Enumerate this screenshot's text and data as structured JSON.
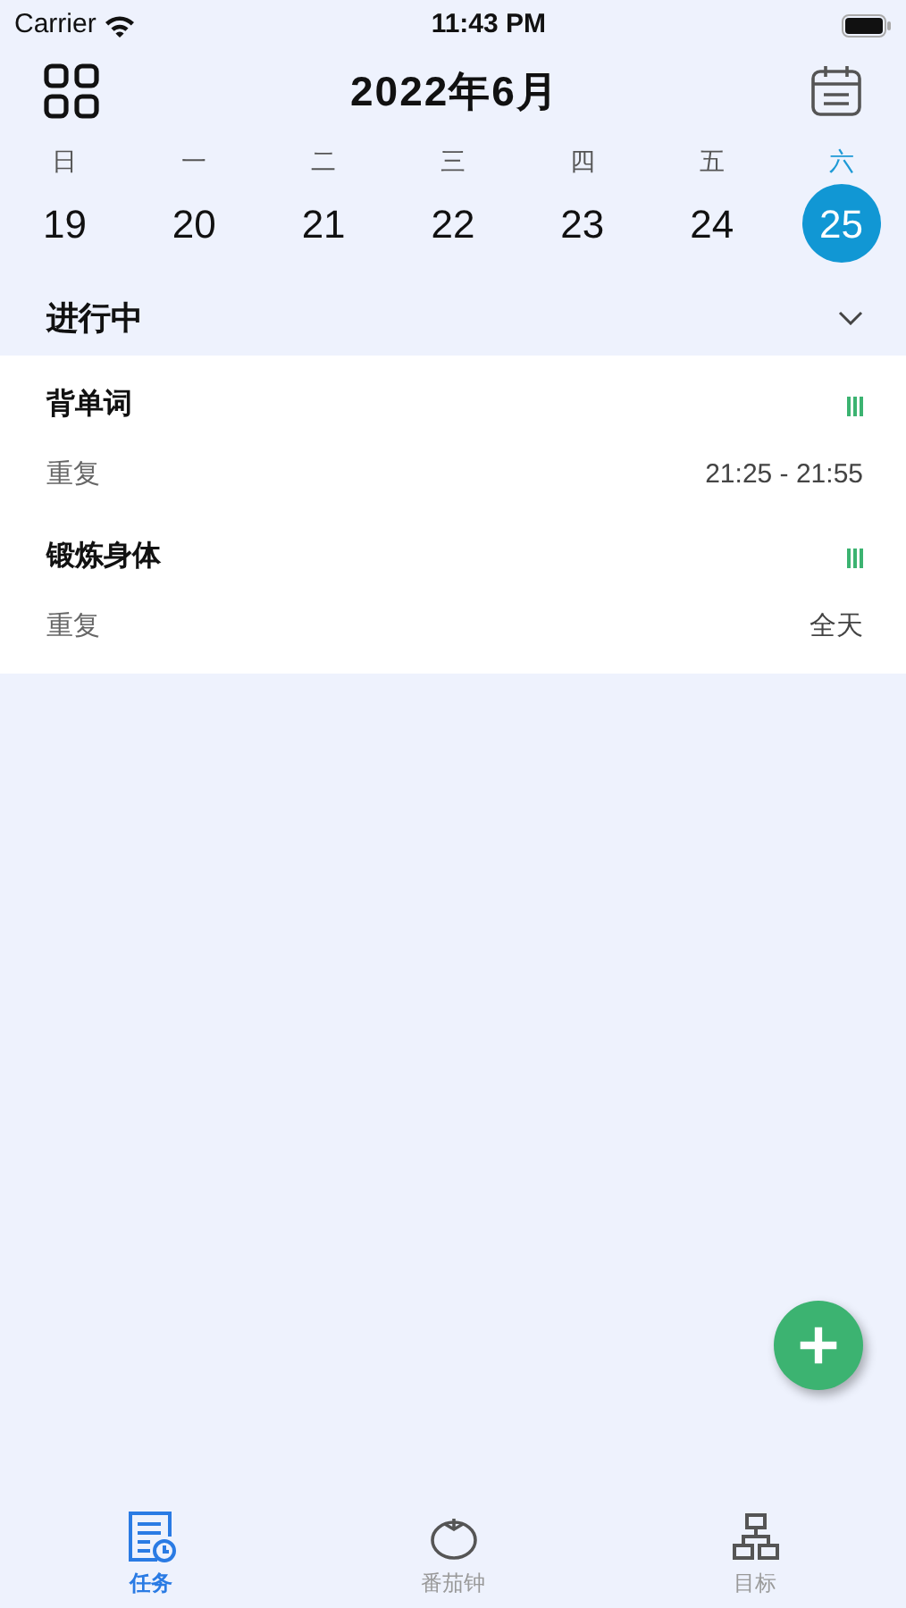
{
  "status_bar": {
    "carrier": "Carrier",
    "time": "11:43 PM"
  },
  "header": {
    "title": "2022年6月"
  },
  "week": [
    {
      "weekday": "日",
      "date": "19",
      "selected": false
    },
    {
      "weekday": "一",
      "date": "20",
      "selected": false
    },
    {
      "weekday": "二",
      "date": "21",
      "selected": false
    },
    {
      "weekday": "三",
      "date": "22",
      "selected": false
    },
    {
      "weekday": "四",
      "date": "23",
      "selected": false
    },
    {
      "weekday": "五",
      "date": "24",
      "selected": false
    },
    {
      "weekday": "六",
      "date": "25",
      "selected": true
    }
  ],
  "section": {
    "title": "进行中",
    "expanded": true
  },
  "tasks": [
    {
      "title": "背单词",
      "repeat": "重复",
      "time": "21:25 - 21:55"
    },
    {
      "title": "锻炼身体",
      "repeat": "重复",
      "time": "全天"
    }
  ],
  "tab_bar": [
    {
      "label": "任务",
      "kind": "tasks",
      "selected": true
    },
    {
      "label": "番茄钟",
      "kind": "tomato",
      "selected": false
    },
    {
      "label": "目标",
      "kind": "goals",
      "selected": false
    }
  ]
}
